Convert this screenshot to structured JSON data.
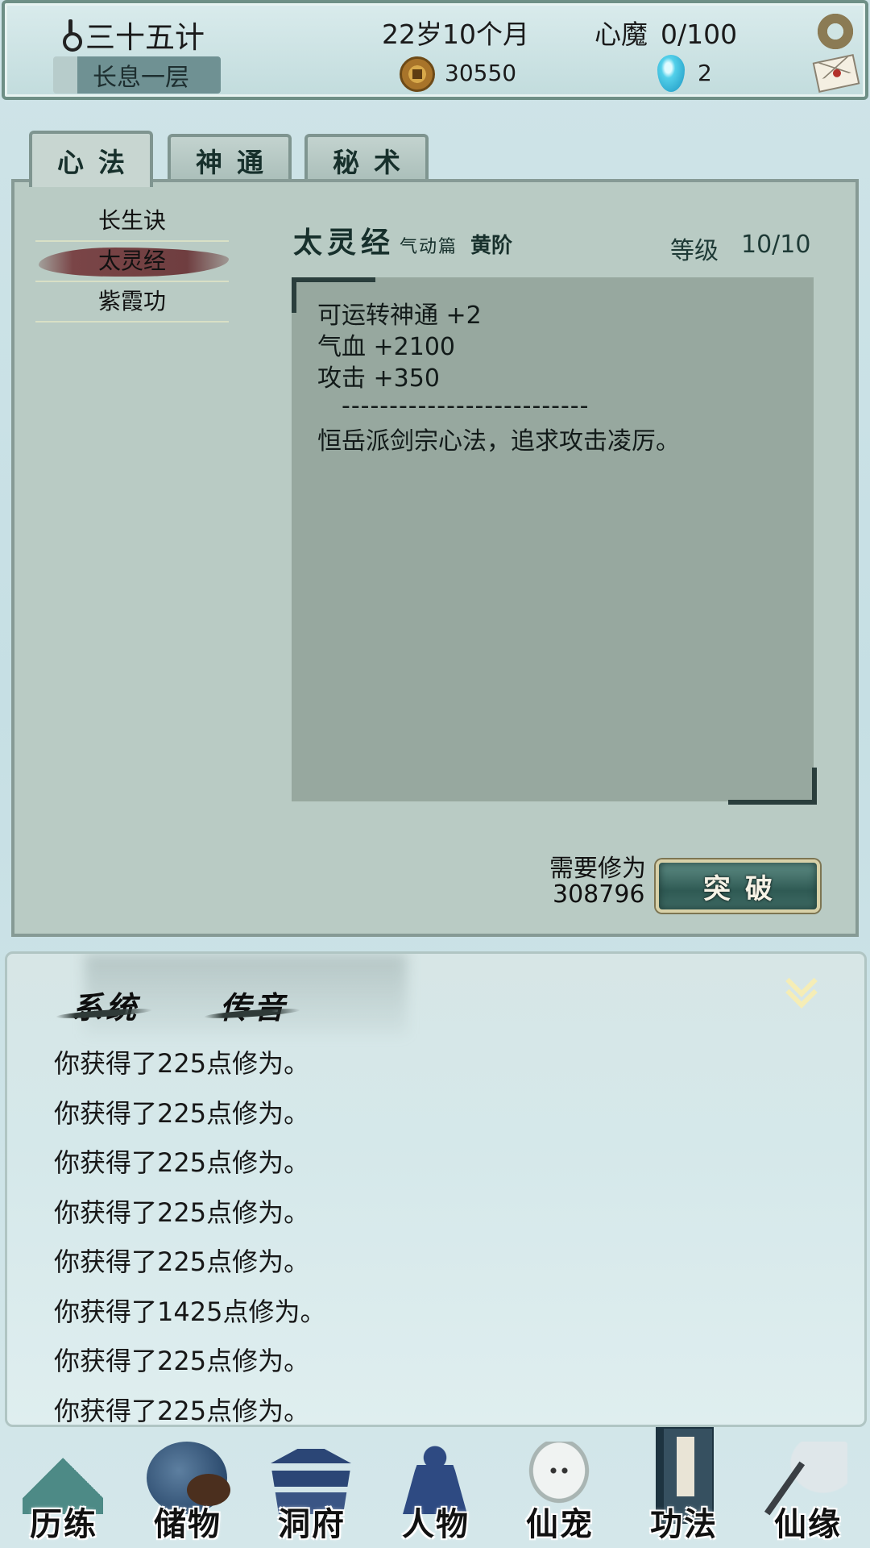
{
  "topbar": {
    "player_name": "三十五计",
    "realm": "长息一层",
    "age": "22岁10个月",
    "demon_label": "心魔",
    "demon_value": "0/100",
    "money": "30550",
    "gems": "2",
    "icons": {
      "player": "key-icon",
      "money": "coin-icon",
      "gems": "gem-icon",
      "settings": "gear-icon",
      "mail": "mail-icon"
    }
  },
  "tabs": [
    {
      "label": "心法",
      "active": true
    },
    {
      "label": "神通",
      "active": false
    },
    {
      "label": "秘术",
      "active": false
    }
  ],
  "skills": {
    "items": [
      "长生诀",
      "太灵经",
      "紫霞功"
    ],
    "selected_index": 1
  },
  "detail": {
    "name": "太灵经",
    "section": "气动篇",
    "grade": "黄阶",
    "level_label": "等级",
    "level_value": "10/10",
    "lines": [
      "可运转神通 +2",
      "气血 +2100",
      "攻击 +350"
    ],
    "divider": "--------------------------",
    "description": "恒岳派剑宗心法，追求攻击凌厉。",
    "need_label": "需要修为",
    "need_value": "308796",
    "breakthrough_label": "突破"
  },
  "chat": {
    "tabs": [
      "系统",
      "传音"
    ],
    "messages": [
      "你获得了225点修为。",
      "你获得了225点修为。",
      "你获得了225点修为。",
      "你获得了225点修为。",
      "你获得了225点修为。",
      "你获得了1425点修为。",
      "你获得了225点修为。",
      "你获得了225点修为。"
    ]
  },
  "bottom_nav": {
    "items": [
      {
        "label": "历练",
        "icon": "mountain-icon"
      },
      {
        "label": "储物",
        "icon": "bag-icon"
      },
      {
        "label": "洞府",
        "icon": "palace-icon"
      },
      {
        "label": "人物",
        "icon": "person-icon"
      },
      {
        "label": "仙宠",
        "icon": "pet-icon"
      },
      {
        "label": "功法",
        "icon": "book-icon",
        "active": true
      },
      {
        "label": "仙缘",
        "icon": "crane-icon"
      }
    ]
  },
  "colors": {
    "panel": "#b9cbc4",
    "desc_box": "#97a89f",
    "accent_dark": "#17302c",
    "selection": "#7a4547",
    "button": "#2f5a54"
  }
}
